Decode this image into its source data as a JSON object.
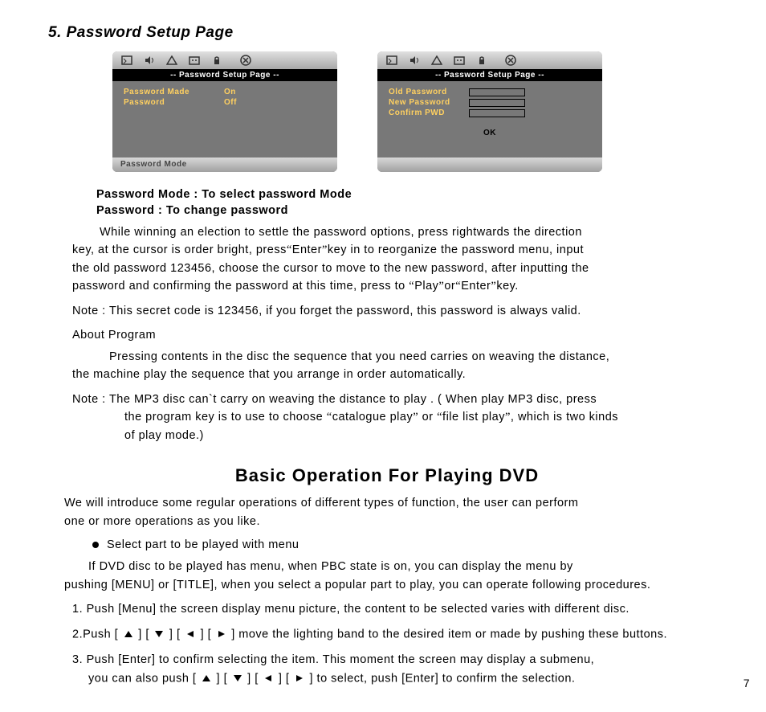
{
  "section": {
    "title": "5. Password Setup Page"
  },
  "panel_left": {
    "title": "--  Password Setup Page  --",
    "row1_label": "Password Made",
    "row1_value": "On",
    "row2_label": "Password",
    "row2_value": "Off",
    "footer": "Password Mode"
  },
  "panel_right": {
    "title": "--  Password Setup Page  --",
    "old": "Old Password",
    "new": "New Password",
    "confirm": "Confirm PWD",
    "ok": "OK"
  },
  "desc1": "Password Mode : To select password Mode",
  "desc2": "Password : To change password",
  "para1a": "While winning an election to settle the password options, press rightwards the direction",
  "para1b": "key, at the cursor is order bright, press",
  "para1c": "Enter",
  "para1d": "key in to reorganize the password menu, input",
  "para1e": "the old password 123456, choose the cursor to move to the new password, after inputting the",
  "para1f": "password and confirming the password at this time, press to",
  "para1g": "Play",
  "para1h": "or",
  "para1i": "Enter",
  "para1j": "key.",
  "note1": "Note : This secret code is 123456, if you forget the password, this password is always valid.",
  "about": "About Program",
  "para2a": "Pressing contents in the disc the sequence that you need carries on weaving the distance,",
  "para2b": "the machine play the sequence that you arrange in order automatically.",
  "note2a": "Note : The MP3 disc can`t carry on weaving the distance to play . ( When play MP3 disc, press",
  "note2b": "the program key is to use to choose",
  "note2c": "catalogue  play",
  "note2d": "or",
  "note2e": "file list play",
  "note2f": ", which is two kinds",
  "note2g": "of play mode.)",
  "h2": "Basic Operation For Playing DVD",
  "intro1": "We will introduce some regular operations of different types of function, the user can perform",
  "intro2": "one or more operations as you like.",
  "bullet": "Select part to be played with menu",
  "dvd1": "If DVD disc to be played has menu, when PBC state is on, you can display the menu by",
  "dvd2": "pushing [MENU] or [TITLE], when you select a popular part to play, you can operate following procedures.",
  "step1": "1. Push [Menu] the screen display menu picture, the content to be selected varies with different disc.",
  "step2a": "2.Push [",
  "step2b": "] [",
  "step2c": "] [",
  "step2d": "] [",
  "step2e": "] move the lighting band to the desired item or made by pushing these buttons.",
  "step3a": "3. Push [Enter] to confirm selecting the item. This moment the screen may display a submenu,",
  "step3b": "you can also push [",
  "step3c": "] [",
  "step3d": "] [",
  "step3e": "] [",
  "step3f": "] to select, push [Enter] to confirm the selection.",
  "page": "7"
}
